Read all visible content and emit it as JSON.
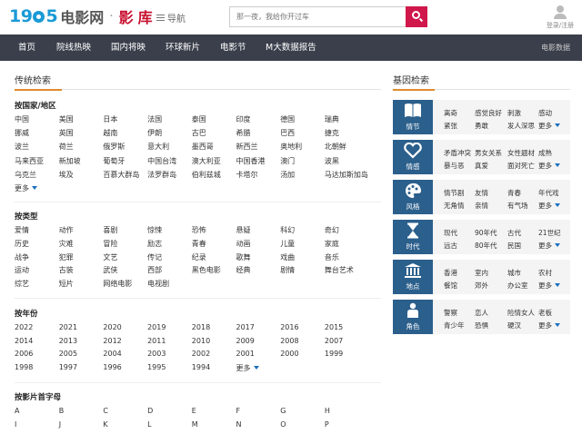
{
  "header": {
    "logo_digits": "19",
    "logo_digits_end": "5",
    "logo_text": "电影网",
    "logo_sep": "·",
    "logo_library": "影库",
    "nav_toggle": "导航",
    "search_placeholder": "那一夜，我给你开过车",
    "user_label": "登录/注册"
  },
  "navbar": {
    "items": [
      "首页",
      "院线热映",
      "国内将映",
      "环球新片",
      "电影节",
      "M大数据报告"
    ],
    "right": "电影数据"
  },
  "traditional": {
    "title": "传统检索",
    "more": "更多",
    "region": {
      "title": "按国家/地区",
      "items": [
        "中国",
        "美国",
        "日本",
        "法国",
        "泰国",
        "印度",
        "德国",
        "瑞典",
        "挪威",
        "英国",
        "越南",
        "伊朗",
        "古巴",
        "希腊",
        "巴西",
        "捷克",
        "波兰",
        "荷兰",
        "俄罗斯",
        "意大利",
        "墨西哥",
        "新西兰",
        "奥地利",
        "北朝鲜",
        "马来西亚",
        "新加坡",
        "葡萄牙",
        "中国台湾",
        "澳大利亚",
        "中国香港",
        "澳门",
        "波黑",
        "乌克兰",
        "埃及",
        "百慕大群岛",
        "法罗群岛",
        "伯利兹城",
        "卡塔尔",
        "汤加",
        "马达加斯加岛"
      ]
    },
    "genre": {
      "title": "按类型",
      "items": [
        "爱情",
        "动作",
        "喜剧",
        "惊悚",
        "恐怖",
        "悬疑",
        "科幻",
        "奇幻",
        "历史",
        "灾难",
        "冒险",
        "励志",
        "青春",
        "动画",
        "儿童",
        "家庭",
        "战争",
        "犯罪",
        "文艺",
        "传记",
        "纪录",
        "歌舞",
        "戏曲",
        "音乐",
        "运动",
        "古装",
        "武侠",
        "西部",
        "黑色电影",
        "经典",
        "剧情",
        "舞台艺术",
        "综艺",
        "短片",
        "网络电影",
        "电视剧"
      ]
    },
    "year": {
      "title": "按年份",
      "items": [
        "2022",
        "2021",
        "2020",
        "2019",
        "2018",
        "2017",
        "2016",
        "2015",
        "2014",
        "2013",
        "2012",
        "2011",
        "2010",
        "2009",
        "2008",
        "2007",
        "2006",
        "2005",
        "2004",
        "2003",
        "2002",
        "2001",
        "2000",
        "1999",
        "1998",
        "1997",
        "1996",
        "1995",
        "1994"
      ]
    },
    "letter": {
      "title": "按影片首字母",
      "items": [
        "A",
        "B",
        "C",
        "D",
        "E",
        "F",
        "G",
        "H",
        "I",
        "J",
        "K",
        "L",
        "M",
        "N",
        "O",
        "P"
      ]
    }
  },
  "gene": {
    "title": "基因检索",
    "more": "更多",
    "rows": [
      {
        "label": "情节",
        "icon": "book-icon",
        "words": [
          "离奇",
          "感觉良好",
          "刺激",
          "感动",
          "紧张",
          "勇敢",
          "发人深思"
        ]
      },
      {
        "label": "情感",
        "icon": "heart-icon",
        "words": [
          "矛盾冲突",
          "男女关系",
          "女性题材",
          "成熟",
          "暴与恶",
          "真爱",
          "面对死亡"
        ]
      },
      {
        "label": "风格",
        "icon": "palette-icon",
        "words": [
          "情节剧",
          "友情",
          "青春",
          "年代戏",
          "无角情",
          "亲情",
          "有气场"
        ]
      },
      {
        "label": "时代",
        "icon": "hourglass-icon",
        "words": [
          "现代",
          "90年代",
          "古代",
          "21世纪",
          "远古",
          "80年代",
          "民国"
        ]
      },
      {
        "label": "地点",
        "icon": "building-icon",
        "words": [
          "香港",
          "室内",
          "城市",
          "农村",
          "餐馆",
          "郊外",
          "办公室"
        ]
      },
      {
        "label": "角色",
        "icon": "person-icon",
        "words": [
          "警察",
          "恋人",
          "险情女人",
          "老板",
          "青少年",
          "恐惧",
          "硬汉"
        ]
      }
    ]
  },
  "colors": {
    "navbar": "#3a3f4b",
    "brand_blue": "#1a9ad6",
    "brand_red": "#c8102e",
    "search_button": "#d0174b",
    "gene_icon_bg": "#2b5f8c",
    "more_link": "#1a6fbf",
    "accent_underline": "#e08b2c"
  }
}
